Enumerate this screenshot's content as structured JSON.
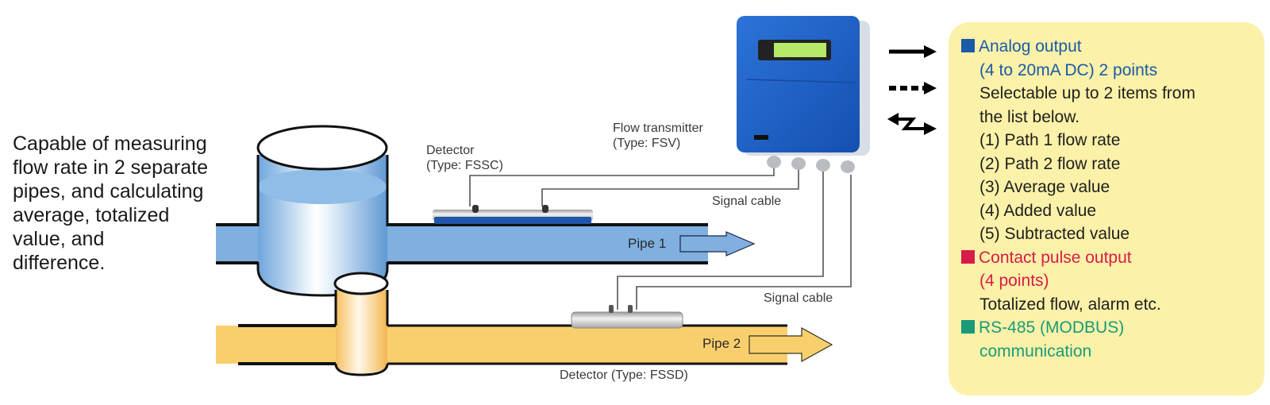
{
  "intro": {
    "lines": [
      "Capable of measuring",
      "flow rate in 2 separate",
      "pipes, and calculating",
      "average, totalized",
      "value, and",
      "difference."
    ]
  },
  "labels": {
    "detector1": [
      "Detector",
      "(Type: FSSC)"
    ],
    "transmitter": [
      "Flow transmitter",
      "(Type: FSV)"
    ],
    "signal_cable_1": "Signal cable",
    "signal_cable_2": "Signal cable",
    "pipe1": "Pipe 1",
    "pipe2": "Pipe 2",
    "detector2": "Detector (Type: FSSD)"
  },
  "arrows": [
    {
      "type": "solid",
      "meaning": "analog-output"
    },
    {
      "type": "dashed",
      "meaning": "contact-pulse-output"
    },
    {
      "type": "bidirectional-zigzag",
      "meaning": "rs485-communication"
    }
  ],
  "panel": {
    "analog": {
      "color": "#1b5aa6",
      "title": "Analog output",
      "subtitle": "(4 to 20mA DC) 2 points",
      "desc": [
        "Selectable up to 2 items from",
        "the list below."
      ],
      "items": [
        "(1) Path 1 flow rate",
        "(2) Path 2 flow rate",
        "(3) Average value",
        "(4) Added value",
        "(5) Subtracted value"
      ]
    },
    "pulse": {
      "color": "#d81b4a",
      "title": "Contact pulse output",
      "subtitle": "(4 points)",
      "desc": "Totalized flow, alarm etc."
    },
    "comm": {
      "color": "#1a9a78",
      "title": "RS-485 (MODBUS)",
      "subtitle": "communication"
    }
  },
  "colors": {
    "pipe1_fill": "#7fb0e0",
    "pipe2_fill": "#f9cf6e",
    "transmitter_body": "#1f5fc8",
    "lcd": "#b6e86a",
    "panel_bg": "#fbf1a8"
  }
}
